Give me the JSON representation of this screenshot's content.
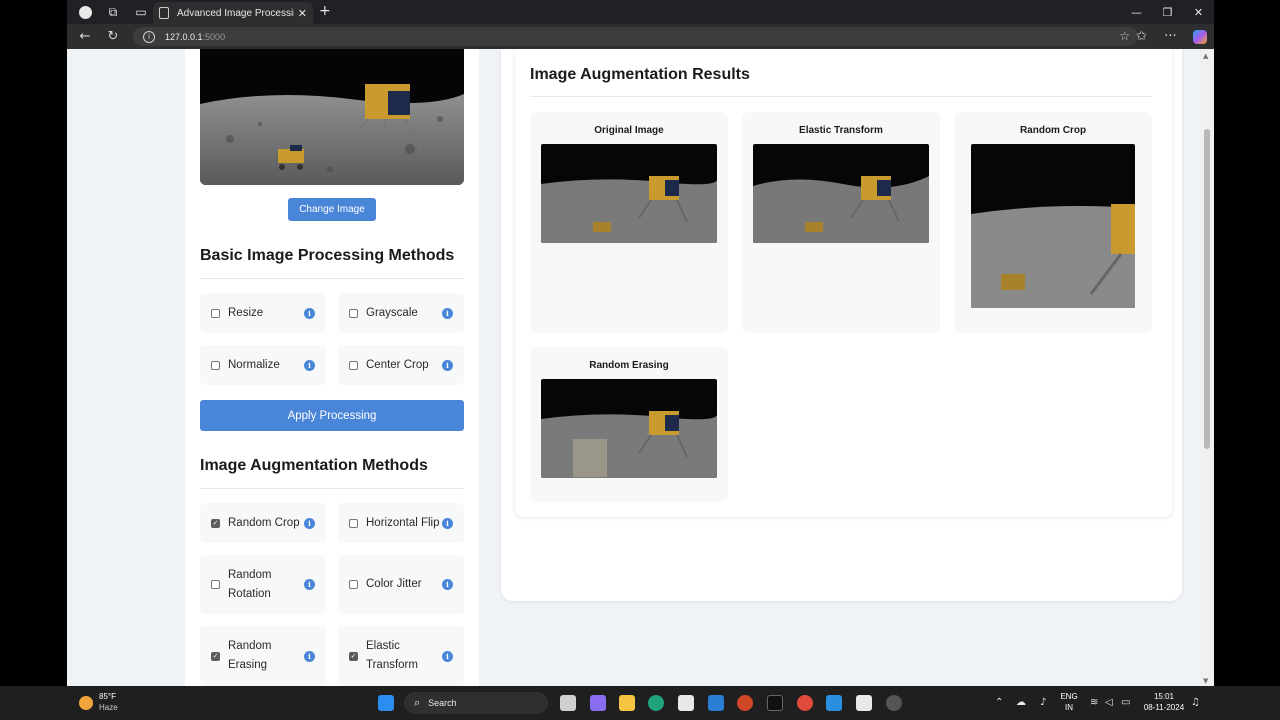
{
  "browser": {
    "tab_title": "Advanced Image Processing Tool",
    "url_host": "127.0.0.1",
    "url_port": ":5000"
  },
  "sidebar": {
    "change_image_label": "Change Image",
    "basic": {
      "title": "Basic Image Processing Methods",
      "options": [
        {
          "label": "Resize",
          "checked": false
        },
        {
          "label": "Grayscale",
          "checked": false
        },
        {
          "label": "Normalize",
          "checked": false
        },
        {
          "label": "Center Crop",
          "checked": false
        }
      ]
    },
    "apply_label": "Apply Processing",
    "augmentation": {
      "title": "Image Augmentation Methods",
      "options": [
        {
          "label": "Random Crop",
          "checked": true
        },
        {
          "label": "Horizontal Flip",
          "checked": false
        },
        {
          "label": "Random Rotation",
          "checked": false
        },
        {
          "label": "Color Jitter",
          "checked": false
        },
        {
          "label": "Random Erasing",
          "checked": true
        },
        {
          "label": "Elastic Transform",
          "checked": true
        }
      ]
    }
  },
  "results": {
    "title": "Image Augmentation Results",
    "cards": [
      {
        "label": "Original Image"
      },
      {
        "label": "Elastic Transform"
      },
      {
        "label": "Random Crop"
      },
      {
        "label": "Random Erasing"
      }
    ]
  },
  "taskbar": {
    "weather_temp": "85°F",
    "weather_desc": "Haze",
    "search_label": "Search",
    "lang_top": "ENG",
    "lang_bottom": "IN",
    "time": "15:01",
    "date": "08-11-2024"
  }
}
